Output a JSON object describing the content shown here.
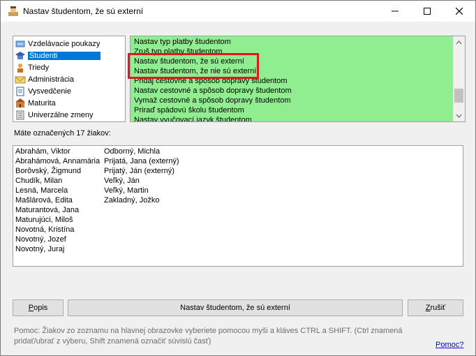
{
  "window": {
    "title": "Nastav študentom, že sú externí",
    "icon": "user-app-icon"
  },
  "categories": [
    {
      "label": "Vzdelávacie poukazy",
      "icon": "voucher-icon",
      "selected": false
    },
    {
      "label": "Študenti",
      "icon": "student-icon",
      "selected": true
    },
    {
      "label": "Triedy",
      "icon": "class-icon",
      "selected": false
    },
    {
      "label": "Administrácia",
      "icon": "envelope-icon",
      "selected": false
    },
    {
      "label": "Vysvedčenie",
      "icon": "certificate-icon",
      "selected": false
    },
    {
      "label": "Maturita",
      "icon": "school-icon",
      "selected": false
    },
    {
      "label": "Univerzálne zmeny",
      "icon": "document-icon",
      "selected": false
    }
  ],
  "actions": [
    "Nastav typ platby študentom",
    "Zruš typ platby študentom",
    "Nastav študentom, že sú externí",
    "Nastav študentom, že nie sú externí",
    "Pridaj cestovné a spôsob dopravy študentom",
    "Nastav cestovné a spôsob dopravy študentom",
    "Vymaž cestovné a spôsob dopravy študentom",
    "Priraď spádovú školu študentom",
    "Nastav vyučovací jazyk študentom"
  ],
  "count_label": "Máte označených 17 žiakov:",
  "students_col1": [
    "Abrahám, Viktor",
    "Abrahámová, Annamária",
    "Borôvský, Žigmund",
    "Chudík, Milan",
    "Lesná, Marcela",
    "Mašlárová, Edita",
    "Maturantová, Jana",
    "Maturujúci, Miloš",
    "Novotná, Kristína",
    "Novotný, Jozef",
    "Novotný, Juraj"
  ],
  "students_col2": [
    "Odborný, Michla",
    "Prijatá, Jana (externý)",
    "Prijatý, Ján (externý)",
    "Veľký, Ján",
    "Veľký, Martin",
    "Zakladný, Jožko"
  ],
  "buttons": {
    "popis": "Popis",
    "main": "Nastav študentom, že sú externí",
    "cancel": "Zrušiť"
  },
  "help": {
    "text": "Pomoc: Žiakov zo zoznamu na hlavnej obrazovke vyberiete pomocou myši a kláves CTRL a SHIFT. (Ctrl znamená pridať/ubrať z výberu, Shift znamená označiť súvislú časť)",
    "link": "Pomoc?"
  },
  "colors": {
    "action_bg": "#90ee90",
    "selection": "#0078d7",
    "highlight": "#e0191e"
  }
}
